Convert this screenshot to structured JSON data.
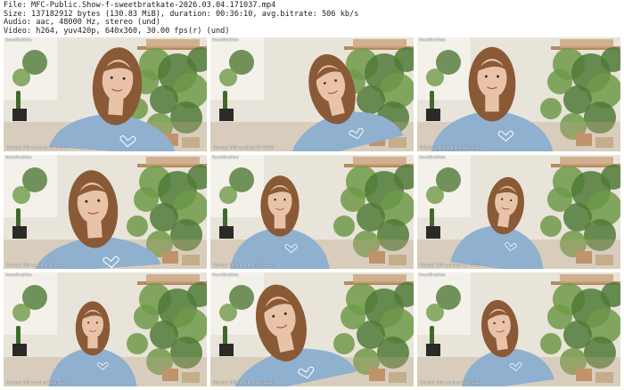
{
  "header": {
    "line1": "File: MFC-Public.Show-f-sweetbratkate-2026.03.04.171037.mp4",
    "line2": "Size: 137182912 bytes (130.83 MiB), duration: 00:36:10, avg.bitrate: 506 kb/s",
    "line3": "Audio: aac, 48000 Hz, stereo (und)",
    "line4": "Video: h264, yuv420p, 640x360, 30.00 fps(r) (und)"
  },
  "thumbnails": [
    {
      "caption_top": "SweetBratKate",
      "caption_bottom": "Nobody! 200x grabbed 3/2 (TLES)"
    },
    {
      "caption_top": "SweetBratKate",
      "caption_bottom": "Nobody! 200x grabbed 3/2 (TLES)"
    },
    {
      "caption_top": "SweetBratKate",
      "caption_bottom": "Nobody! 200x grabbed 3/2 (TLES)"
    },
    {
      "caption_top": "SweetBratKate",
      "caption_bottom": "Nobody! 200x grabbed 3/2 (TLES)"
    },
    {
      "caption_top": "SweetBratKate",
      "caption_bottom": "Nobody! 200x grabbed 3/2 (TLES)"
    },
    {
      "caption_top": "SweetBratKate",
      "caption_bottom": "Nobody! 200x grabbed 3/2 (TLES)"
    },
    {
      "caption_top": "SweetBratKate",
      "caption_bottom": "Nobody! 200x grabbed 3/2 (TLES)"
    },
    {
      "caption_top": "SweetBratKate",
      "caption_bottom": "Nobody! 200x grabbed 3/2 (TLES)"
    },
    {
      "caption_top": "SweetBratKate",
      "caption_bottom": "Nobody! 200x grabbed 3/2 (TLES)"
    }
  ],
  "colors": {
    "wall": "#e8e4da",
    "sweater": "#8fb0cf",
    "hair": "#8a5a36",
    "skin": "#e9c3a8",
    "plant": "#4f7a36",
    "pot": "#2b2a28",
    "shelf": "#b58a5e"
  }
}
